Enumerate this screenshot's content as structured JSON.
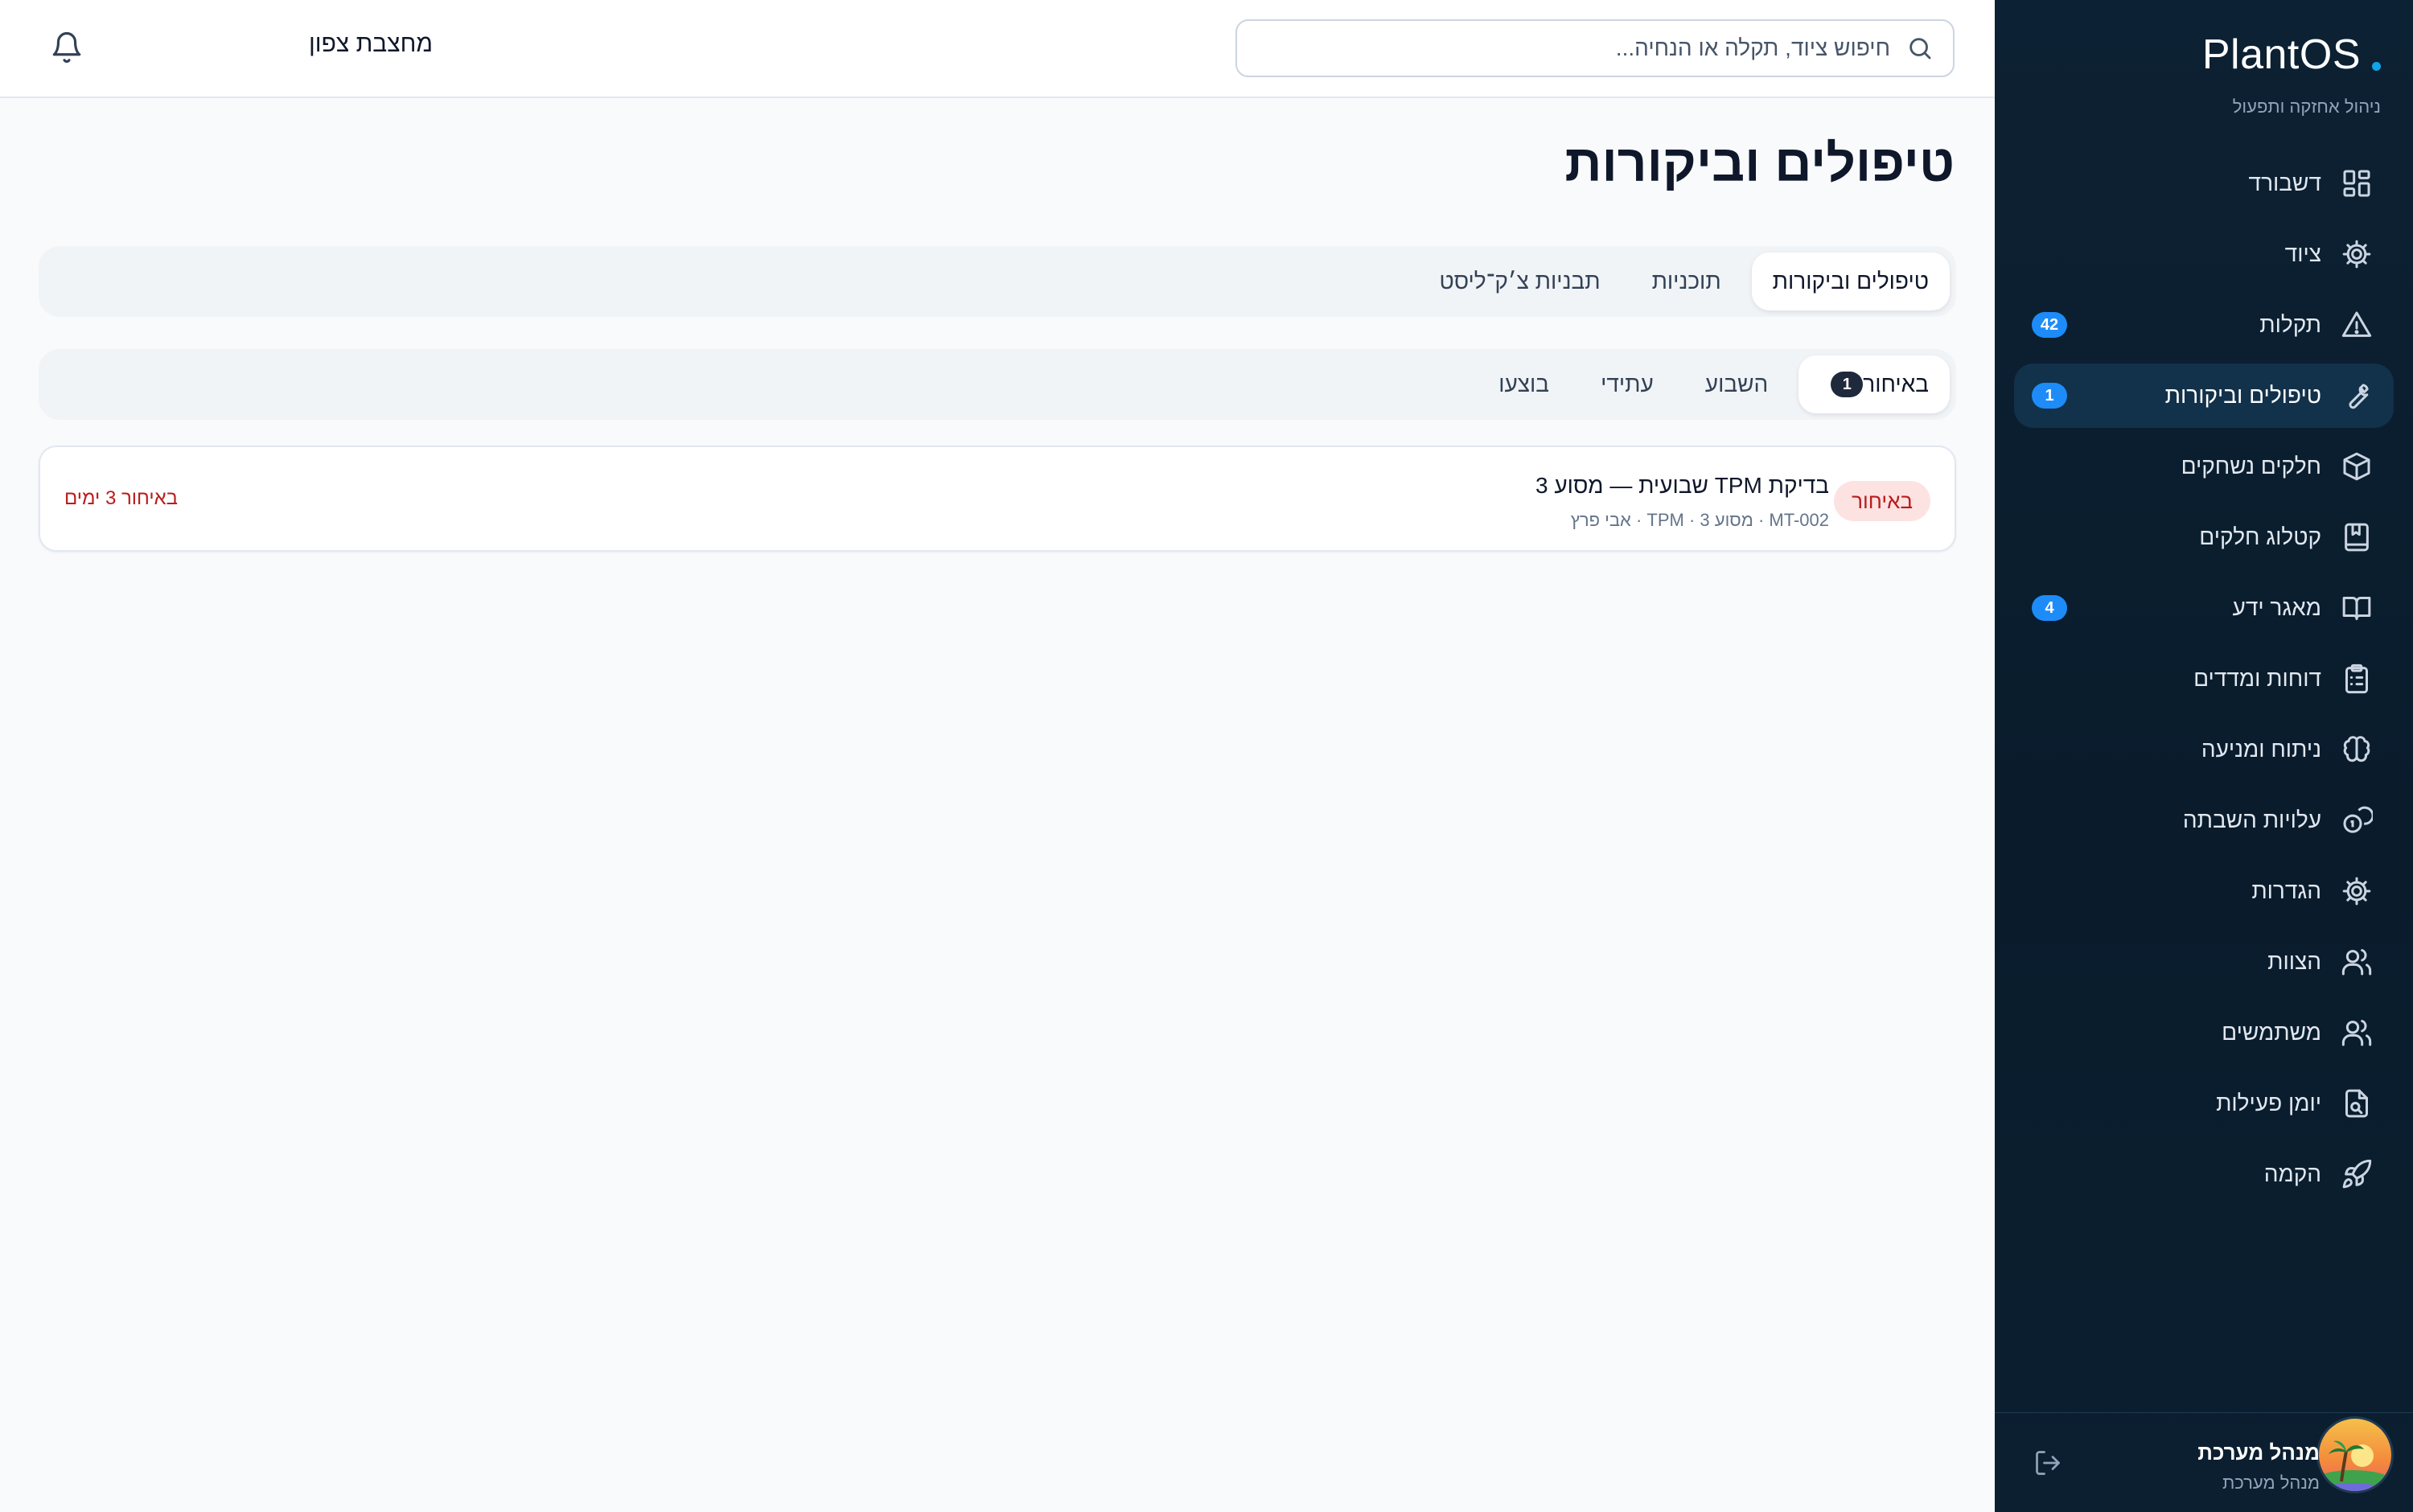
{
  "app": {
    "brand": "PlantOS",
    "subtitle": "ניהול אחזקה ותפעול"
  },
  "colors": {
    "sidebar_bg": "#0c2133",
    "accent": "#1d8cf8",
    "overdue": "#b91c1c",
    "overdue_bg": "#fde2e2"
  },
  "sidebar": {
    "items": [
      {
        "label": "דשבורד",
        "icon": "dashboard-icon",
        "badge": ""
      },
      {
        "label": "ציוד",
        "icon": "gear-icon",
        "badge": ""
      },
      {
        "label": "תקלות",
        "icon": "alert-triangle-icon",
        "badge": "42"
      },
      {
        "label": "טיפולים וביקורות",
        "icon": "wrench-icon",
        "badge": "1",
        "active": true
      },
      {
        "label": "חלקים נשחקים",
        "icon": "package-icon",
        "badge": ""
      },
      {
        "label": "קטלוג חלקים",
        "icon": "book-bookmark-icon",
        "badge": ""
      },
      {
        "label": "מאגר ידע",
        "icon": "book-open-icon",
        "badge": "4"
      },
      {
        "label": "דוחות ומדדים",
        "icon": "clipboard-list-icon",
        "badge": ""
      },
      {
        "label": "ניתוח ומניעה",
        "icon": "brain-icon",
        "badge": ""
      },
      {
        "label": "עלויות השבתה",
        "icon": "coins-icon",
        "badge": ""
      },
      {
        "label": "הגדרות",
        "icon": "settings-icon",
        "badge": ""
      },
      {
        "label": "הצוות",
        "icon": "team-icon",
        "badge": ""
      },
      {
        "label": "משתמשים",
        "icon": "users-icon",
        "badge": ""
      },
      {
        "label": "יומן פעילות",
        "icon": "file-search-icon",
        "badge": ""
      },
      {
        "label": "הקמה",
        "icon": "rocket-icon",
        "badge": ""
      }
    ]
  },
  "user": {
    "name": "מנהל מערכת",
    "role": "מנהל מערכת",
    "avatar_icon": "avatar-palm-icon"
  },
  "topbar": {
    "search_placeholder": "חיפוש ציוד, תקלה או הנחיה...",
    "site": "מחצבת צפון"
  },
  "page": {
    "title": "טיפולים וביקורות",
    "tabs": [
      "טיפולים וביקורות",
      "תוכניות",
      "תבניות צ׳ק־ליסט"
    ],
    "filters": [
      {
        "label": "באיחור",
        "count": "1"
      },
      {
        "label": "השבוע",
        "count": ""
      },
      {
        "label": "עתידי",
        "count": ""
      },
      {
        "label": "בוצעו",
        "count": ""
      }
    ],
    "tasks": [
      {
        "status": "באיחור",
        "title": "בדיקת TPM שבועית — מסוע 3",
        "meta": "MT-002 · מסוע 3 · TPM · אבי פרץ",
        "overdue": "באיחור 3 ימים"
      }
    ]
  }
}
